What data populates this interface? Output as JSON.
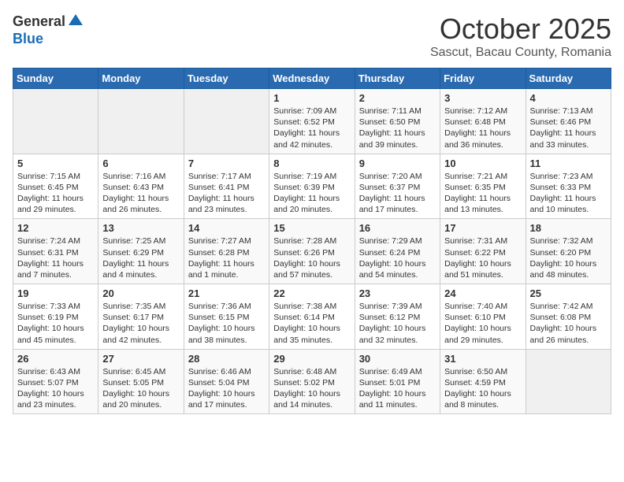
{
  "header": {
    "logo_general": "General",
    "logo_blue": "Blue",
    "month_title": "October 2025",
    "subtitle": "Sascut, Bacau County, Romania"
  },
  "weekdays": [
    "Sunday",
    "Monday",
    "Tuesday",
    "Wednesday",
    "Thursday",
    "Friday",
    "Saturday"
  ],
  "weeks": [
    [
      {
        "day": "",
        "info": ""
      },
      {
        "day": "",
        "info": ""
      },
      {
        "day": "",
        "info": ""
      },
      {
        "day": "1",
        "info": "Sunrise: 7:09 AM\nSunset: 6:52 PM\nDaylight: 11 hours\nand 42 minutes."
      },
      {
        "day": "2",
        "info": "Sunrise: 7:11 AM\nSunset: 6:50 PM\nDaylight: 11 hours\nand 39 minutes."
      },
      {
        "day": "3",
        "info": "Sunrise: 7:12 AM\nSunset: 6:48 PM\nDaylight: 11 hours\nand 36 minutes."
      },
      {
        "day": "4",
        "info": "Sunrise: 7:13 AM\nSunset: 6:46 PM\nDaylight: 11 hours\nand 33 minutes."
      }
    ],
    [
      {
        "day": "5",
        "info": "Sunrise: 7:15 AM\nSunset: 6:45 PM\nDaylight: 11 hours\nand 29 minutes."
      },
      {
        "day": "6",
        "info": "Sunrise: 7:16 AM\nSunset: 6:43 PM\nDaylight: 11 hours\nand 26 minutes."
      },
      {
        "day": "7",
        "info": "Sunrise: 7:17 AM\nSunset: 6:41 PM\nDaylight: 11 hours\nand 23 minutes."
      },
      {
        "day": "8",
        "info": "Sunrise: 7:19 AM\nSunset: 6:39 PM\nDaylight: 11 hours\nand 20 minutes."
      },
      {
        "day": "9",
        "info": "Sunrise: 7:20 AM\nSunset: 6:37 PM\nDaylight: 11 hours\nand 17 minutes."
      },
      {
        "day": "10",
        "info": "Sunrise: 7:21 AM\nSunset: 6:35 PM\nDaylight: 11 hours\nand 13 minutes."
      },
      {
        "day": "11",
        "info": "Sunrise: 7:23 AM\nSunset: 6:33 PM\nDaylight: 11 hours\nand 10 minutes."
      }
    ],
    [
      {
        "day": "12",
        "info": "Sunrise: 7:24 AM\nSunset: 6:31 PM\nDaylight: 11 hours\nand 7 minutes."
      },
      {
        "day": "13",
        "info": "Sunrise: 7:25 AM\nSunset: 6:29 PM\nDaylight: 11 hours\nand 4 minutes."
      },
      {
        "day": "14",
        "info": "Sunrise: 7:27 AM\nSunset: 6:28 PM\nDaylight: 11 hours\nand 1 minute."
      },
      {
        "day": "15",
        "info": "Sunrise: 7:28 AM\nSunset: 6:26 PM\nDaylight: 10 hours\nand 57 minutes."
      },
      {
        "day": "16",
        "info": "Sunrise: 7:29 AM\nSunset: 6:24 PM\nDaylight: 10 hours\nand 54 minutes."
      },
      {
        "day": "17",
        "info": "Sunrise: 7:31 AM\nSunset: 6:22 PM\nDaylight: 10 hours\nand 51 minutes."
      },
      {
        "day": "18",
        "info": "Sunrise: 7:32 AM\nSunset: 6:20 PM\nDaylight: 10 hours\nand 48 minutes."
      }
    ],
    [
      {
        "day": "19",
        "info": "Sunrise: 7:33 AM\nSunset: 6:19 PM\nDaylight: 10 hours\nand 45 minutes."
      },
      {
        "day": "20",
        "info": "Sunrise: 7:35 AM\nSunset: 6:17 PM\nDaylight: 10 hours\nand 42 minutes."
      },
      {
        "day": "21",
        "info": "Sunrise: 7:36 AM\nSunset: 6:15 PM\nDaylight: 10 hours\nand 38 minutes."
      },
      {
        "day": "22",
        "info": "Sunrise: 7:38 AM\nSunset: 6:14 PM\nDaylight: 10 hours\nand 35 minutes."
      },
      {
        "day": "23",
        "info": "Sunrise: 7:39 AM\nSunset: 6:12 PM\nDaylight: 10 hours\nand 32 minutes."
      },
      {
        "day": "24",
        "info": "Sunrise: 7:40 AM\nSunset: 6:10 PM\nDaylight: 10 hours\nand 29 minutes."
      },
      {
        "day": "25",
        "info": "Sunrise: 7:42 AM\nSunset: 6:08 PM\nDaylight: 10 hours\nand 26 minutes."
      }
    ],
    [
      {
        "day": "26",
        "info": "Sunrise: 6:43 AM\nSunset: 5:07 PM\nDaylight: 10 hours\nand 23 minutes."
      },
      {
        "day": "27",
        "info": "Sunrise: 6:45 AM\nSunset: 5:05 PM\nDaylight: 10 hours\nand 20 minutes."
      },
      {
        "day": "28",
        "info": "Sunrise: 6:46 AM\nSunset: 5:04 PM\nDaylight: 10 hours\nand 17 minutes."
      },
      {
        "day": "29",
        "info": "Sunrise: 6:48 AM\nSunset: 5:02 PM\nDaylight: 10 hours\nand 14 minutes."
      },
      {
        "day": "30",
        "info": "Sunrise: 6:49 AM\nSunset: 5:01 PM\nDaylight: 10 hours\nand 11 minutes."
      },
      {
        "day": "31",
        "info": "Sunrise: 6:50 AM\nSunset: 4:59 PM\nDaylight: 10 hours\nand 8 minutes."
      },
      {
        "day": "",
        "info": ""
      }
    ]
  ]
}
